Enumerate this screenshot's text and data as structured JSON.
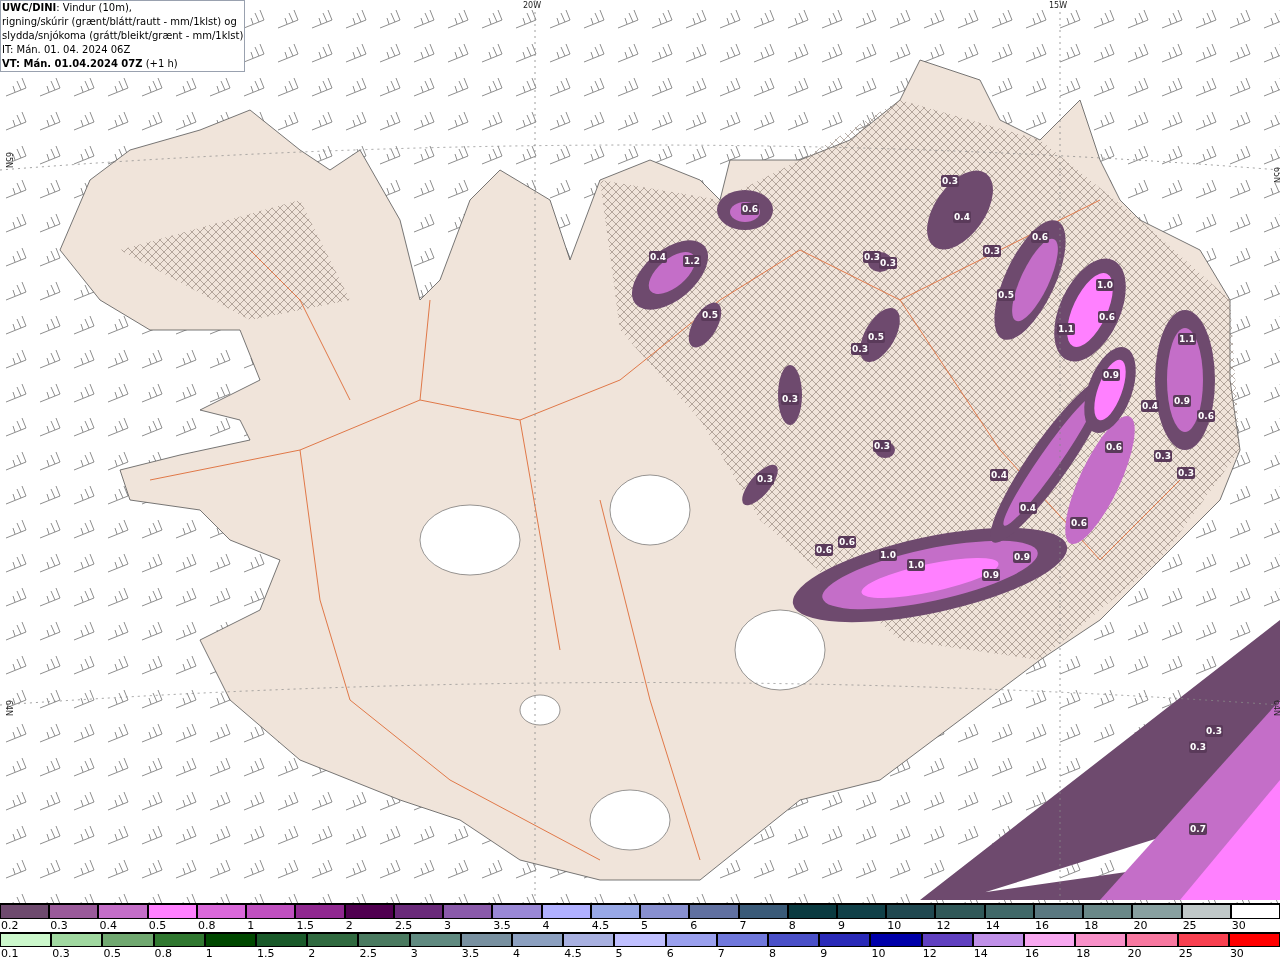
{
  "header": {
    "model": "UWC/DINI",
    "description": ": Vindur (10m),",
    "lines": [
      "rigning/skúrir (grænt/blátt/rautt - mm/1klst) og",
      "slydda/snjókoma (grátt/bleikt/grænt - mm/1klst)",
      "IT: Mán. 01. 04. 2024 06Z"
    ],
    "valid_time": "VT: Mán. 01.04.2024 07Z",
    "offset": "(+1 h)"
  },
  "map": {
    "grid_labels": [
      "20W",
      "15W",
      "65N",
      "65N",
      "64N",
      "64N"
    ],
    "value_labels": [
      "0.3",
      "0.6",
      "0.4",
      "0.6",
      "0.4",
      "1.2",
      "0.3",
      "0.3",
      "0.3",
      "0.5",
      "1.0",
      "0.5",
      "0.6",
      "1.1",
      "0.5",
      "1.1",
      "0.3",
      "0.3",
      "0.9",
      "0.4",
      "0.9",
      "0.6",
      "0.3",
      "0.3",
      "0.3",
      "0.3",
      "0.4",
      "0.6",
      "0.4",
      "0.6",
      "0.6",
      "0.6",
      "1.0",
      "1.0",
      "0.9",
      "0.9",
      "0.3",
      "0.3",
      "0.7"
    ]
  },
  "legend_snow": [
    {
      "label": "0.2",
      "color": "#6e4a6e"
    },
    {
      "label": "0.3",
      "color": "#9a5a9a"
    },
    {
      "label": "0.4",
      "color": "#c46ec8"
    },
    {
      "label": "0.5",
      "color": "#ff80ff"
    },
    {
      "label": "0.8",
      "color": "#da68da"
    },
    {
      "label": "1",
      "color": "#c050c0"
    },
    {
      "label": "1.5",
      "color": "#902890"
    },
    {
      "label": "2",
      "color": "#500050"
    },
    {
      "label": "2.5",
      "color": "#6a2a7a"
    },
    {
      "label": "3",
      "color": "#8a5aaa"
    },
    {
      "label": "3.5",
      "color": "#9a88d6"
    },
    {
      "label": "4",
      "color": "#b0b0ff"
    },
    {
      "label": "4.5",
      "color": "#98a8e6"
    },
    {
      "label": "5",
      "color": "#8890d0"
    },
    {
      "label": "6",
      "color": "#6070a0"
    },
    {
      "label": "7",
      "color": "#3a5a78"
    },
    {
      "label": "8",
      "color": "#0a3a40"
    },
    {
      "label": "9",
      "color": "#104048"
    },
    {
      "label": "10",
      "color": "#204850"
    },
    {
      "label": "12",
      "color": "#305858"
    },
    {
      "label": "14",
      "color": "#406868"
    },
    {
      "label": "16",
      "color": "#5a7880"
    },
    {
      "label": "18",
      "color": "#6a8888"
    },
    {
      "label": "20",
      "color": "#88a0a0"
    },
    {
      "label": "25",
      "color": "#c0c8c8"
    },
    {
      "label": "30",
      "color": "#ffffff"
    }
  ],
  "legend_rain": [
    {
      "label": "0.1",
      "color": "#ccf8cc"
    },
    {
      "label": "0.3",
      "color": "#a0d8a0"
    },
    {
      "label": "0.5",
      "color": "#70a870"
    },
    {
      "label": "0.8",
      "color": "#307830"
    },
    {
      "label": "1",
      "color": "#004800"
    },
    {
      "label": "1.5",
      "color": "#1a5a2a"
    },
    {
      "label": "2",
      "color": "#306a40"
    },
    {
      "label": "2.5",
      "color": "#4a7a60"
    },
    {
      "label": "3",
      "color": "#608a80"
    },
    {
      "label": "3.5",
      "color": "#7890a0"
    },
    {
      "label": "4",
      "color": "#8ca0c0"
    },
    {
      "label": "4.5",
      "color": "#a8b0e0"
    },
    {
      "label": "5",
      "color": "#c0c0ff"
    },
    {
      "label": "6",
      "color": "#9aa0ee"
    },
    {
      "label": "7",
      "color": "#7078dc"
    },
    {
      "label": "8",
      "color": "#4a50c8"
    },
    {
      "label": "9",
      "color": "#2a2ab8"
    },
    {
      "label": "10",
      "color": "#0000aa"
    },
    {
      "label": "12",
      "color": "#6040c0"
    },
    {
      "label": "14",
      "color": "#c090e8"
    },
    {
      "label": "16",
      "color": "#f8a8f0"
    },
    {
      "label": "18",
      "color": "#f890c8"
    },
    {
      "label": "20",
      "color": "#f878a0"
    },
    {
      "label": "25",
      "color": "#f84050"
    },
    {
      "label": "30",
      "color": "#ff0000"
    }
  ]
}
